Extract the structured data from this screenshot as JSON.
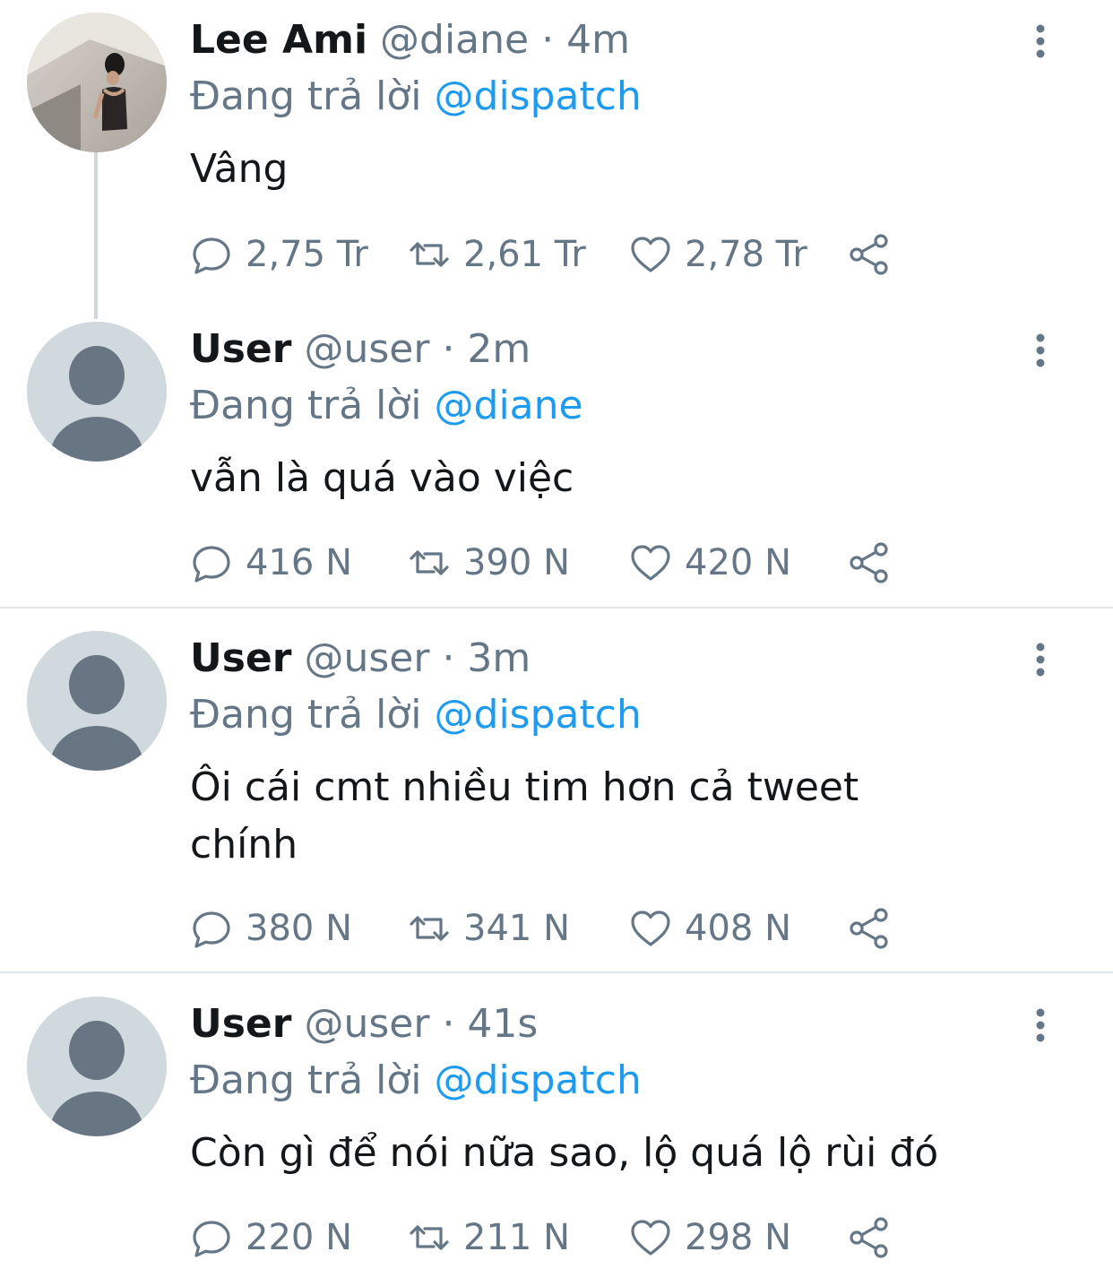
{
  "reply_prefix": "Đang trả lời",
  "colors": {
    "accent": "#1d9bf0",
    "muted": "#657786",
    "text": "#14171a",
    "avatar_bg": "#cfd9de",
    "avatar_fg": "#687684"
  },
  "tweets": [
    {
      "name": "Lee Ami",
      "handle": "@diane",
      "time": "· 4m",
      "reply_to": "@dispatch",
      "text": "Vâng",
      "avatar": "photo-avatar",
      "replies": "2,75 Tr",
      "retweets": "2,61 Tr",
      "likes": "2,78 Tr"
    },
    {
      "name": "User",
      "handle": "@user",
      "time": "· 2m",
      "reply_to": "@diane",
      "text": "vẫn là quá vào việc",
      "avatar": "default-avatar",
      "replies": "416 N",
      "retweets": "390 N",
      "likes": "420 N"
    },
    {
      "name": "User",
      "handle": "@user",
      "time": "· 3m",
      "reply_to": "@dispatch",
      "text": "Ôi cái cmt nhiều tim hơn cả tweet chính",
      "avatar": "default-avatar",
      "replies": "380 N",
      "retweets": "341 N",
      "likes": "408 N"
    },
    {
      "name": "User",
      "handle": "@user",
      "time": "· 41s",
      "reply_to": "@dispatch",
      "text": "Còn gì để nói nữa sao, lộ quá lộ rùi đó",
      "avatar": "default-avatar",
      "replies": "220 N",
      "retweets": "211 N",
      "likes": "298 N"
    }
  ]
}
